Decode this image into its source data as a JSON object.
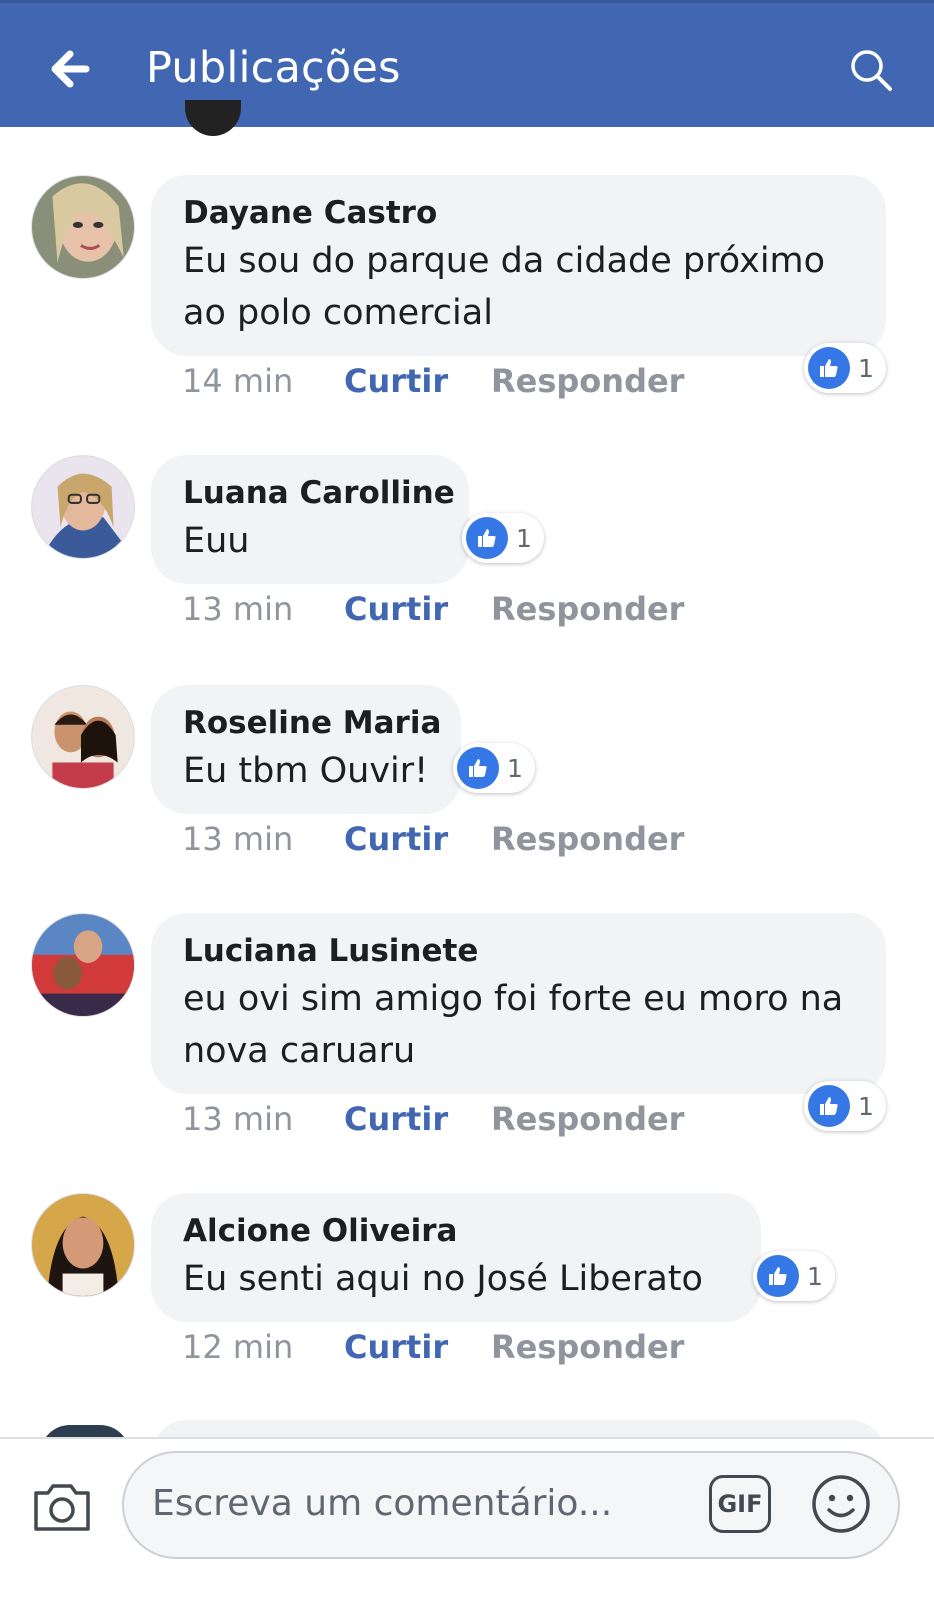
{
  "header": {
    "title": "Publicações"
  },
  "comments": [
    {
      "author": "Dayane Castro",
      "lines": [
        "Eu sou do parque da cidade próximo",
        "ao polo comercial"
      ],
      "time": "14 min",
      "like": "Curtir",
      "reply": "Responder",
      "reactions": "1"
    },
    {
      "author": "Luana Carolline",
      "lines": [
        "Euu"
      ],
      "time": "13 min",
      "like": "Curtir",
      "reply": "Responder",
      "reactions": "1"
    },
    {
      "author": "Roseline Maria",
      "lines": [
        "Eu tbm Ouvir!"
      ],
      "time": "13 min",
      "like": "Curtir",
      "reply": "Responder",
      "reactions": "1"
    },
    {
      "author": "Luciana Lusinete",
      "lines": [
        "eu ovi sim amigo foi forte eu moro na",
        "nova caruaru"
      ],
      "time": "13 min",
      "like": "Curtir",
      "reply": "Responder",
      "reactions": "1"
    },
    {
      "author": "Alcione Oliveira",
      "lines": [
        "Eu senti aqui no José Liberato"
      ],
      "time": "12 min",
      "like": "Curtir",
      "reply": "Responder",
      "reactions": "1"
    }
  ],
  "composer": {
    "placeholder": "Escreva um comentário...",
    "gif_label": "GIF"
  },
  "colors": {
    "header": "#4267b2",
    "like_blue": "#3578e5",
    "link_blue": "#4267b2",
    "bubble": "#f2f3f5"
  }
}
